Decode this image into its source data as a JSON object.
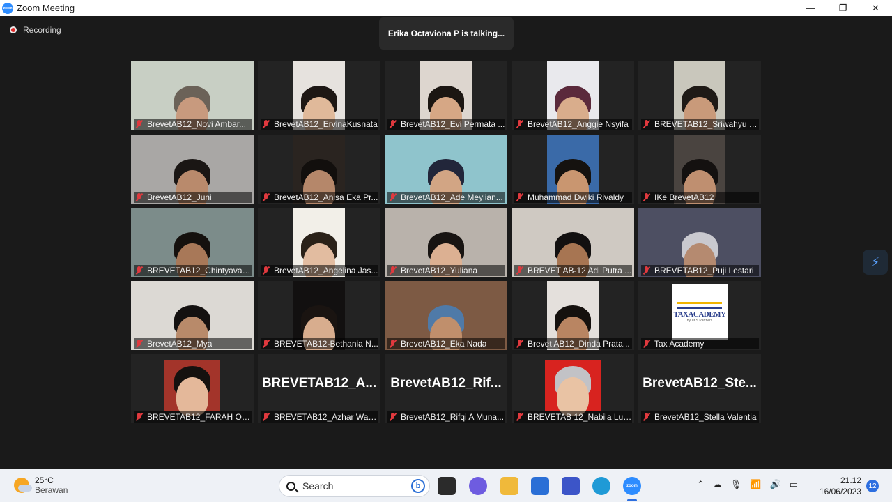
{
  "window": {
    "title": "Zoom Meeting",
    "logo_text": "zoom",
    "controls": {
      "minimize": "—",
      "restore": "❐",
      "close": "✕"
    }
  },
  "meeting": {
    "recording_label": "Recording",
    "talking_banner": "Erika Octaviona P is talking...",
    "side_widget": "⚡"
  },
  "participants": [
    {
      "label": "BrevetAB12_Novi Ambar...",
      "bg": "#c8cfc4",
      "skin": "#c89a7e",
      "hair": "#6b6258",
      "narrow": false
    },
    {
      "label": "BrevetAB12_ErvinaKusnata",
      "bg": "#e6e2de",
      "skin": "#e0b99a",
      "hair": "#1d1714",
      "narrow": true
    },
    {
      "label": "BrevetAB12_Evi Permata ...",
      "bg": "#ddd6cf",
      "skin": "#d6a785",
      "hair": "#1b1612",
      "narrow": true
    },
    {
      "label": "BrevetAB12_Anggie Nsyifa",
      "bg": "#e9e9ed",
      "skin": "#d9ad8c",
      "hair": "#5b2a3c",
      "narrow": true
    },
    {
      "label": "BREVETAB12_Sriwahyu Tj...",
      "bg": "#c9c7bc",
      "skin": "#c99a7a",
      "hair": "#1f1a16",
      "narrow": true
    },
    {
      "label": "BrevetAB12_Juni",
      "bg": "#a9a7a5",
      "skin": "#b98a6c",
      "hair": "#1a1614",
      "narrow": false
    },
    {
      "label": "BrevetAB12_Anisa Eka Pr...",
      "bg": "#2a2420",
      "skin": "#b5876a",
      "hair": "#120f0d",
      "narrow": true
    },
    {
      "label": "BrevetAB12_Ade Meylian...",
      "bg": "#8fc4cc",
      "skin": "#d2a584",
      "hair": "#22263a",
      "narrow": false
    },
    {
      "label": "Muhammad Dwiki Rivaldy",
      "bg": "#3a6aa8",
      "skin": "#c99670",
      "hair": "#15120f",
      "narrow": true
    },
    {
      "label": "IKe BrevetAB12",
      "bg": "#4a4440",
      "skin": "#bf8f70",
      "hair": "#141110",
      "narrow": true
    },
    {
      "label": "BREVETAB12_Chintyavan...",
      "bg": "#7c8c8a",
      "skin": "#a87858",
      "hair": "#15110e",
      "narrow": false
    },
    {
      "label": "BrevetAB12_Angelina Jas...",
      "bg": "#f2efe8",
      "skin": "#e2bca0",
      "hair": "#2a2118",
      "narrow": true
    },
    {
      "label": "BrevetAB12_Yuliana",
      "bg": "#b9b2ab",
      "skin": "#dcb092",
      "hair": "#181412",
      "narrow": false
    },
    {
      "label": "BREVET AB-12 Adi Putra ...",
      "bg": "#cfc9c2",
      "skin": "#a77552",
      "hair": "#121010",
      "narrow": false
    },
    {
      "label": "BREVETAB12_Puji Lestari",
      "bg": "#4d4f62",
      "skin": "#b58a70",
      "hair": "#c9c9cf",
      "narrow": false
    },
    {
      "label": "BrevetAB12_Mya",
      "bg": "#dcd9d4",
      "skin": "#b88a6a",
      "hair": "#141110",
      "narrow": false
    },
    {
      "label": "BREVETAB12-Bethania N...",
      "bg": "#121010",
      "skin": "#d8ad8e",
      "hair": "#1a1411",
      "narrow": true
    },
    {
      "label": "BrevetAB12_Eka Nada",
      "bg": "#7d5a44",
      "skin": "#c08f6c",
      "hair": "#4f7aa8",
      "narrow": false
    },
    {
      "label": "Brevet AB12_Dinda Prata...",
      "bg": "#e4e0dc",
      "skin": "#b98562",
      "hair": "#15110e",
      "narrow": true
    },
    {
      "label": "Tax Academy",
      "logo": true,
      "logo_text": "TAXACADEMY",
      "logo_sub": "by TKS Partners"
    },
    {
      "label": "BREVETAB12_FARAH ORD...",
      "bg": "#a3342a",
      "skin": "#e4b89a",
      "hair": "#15110f",
      "narrow": false,
      "photo": true
    },
    {
      "label": "BREVETAB12_Azhar Wad...",
      "name_only": "BREVETAB12_A..."
    },
    {
      "label": "BrevetAB12_Rifqi A Muna...",
      "name_only": "BrevetAB12_Rif..."
    },
    {
      "label": "BREVETAB 12_Nabila Lut...",
      "bg": "#d8231f",
      "skin": "#e9c3a4",
      "hair": "#c2c2c6",
      "narrow": false,
      "photo": true
    },
    {
      "label": "BrevetAB12_Stella Valentia",
      "name_only": "BrevetAB12_Ste..."
    }
  ],
  "taskbar": {
    "weather_temp": "25°C",
    "weather_desc": "Berawan",
    "search_placeholder": "Search",
    "search_badge": "b",
    "time": "21.12",
    "date": "16/06/2023",
    "notification_count": "12"
  }
}
